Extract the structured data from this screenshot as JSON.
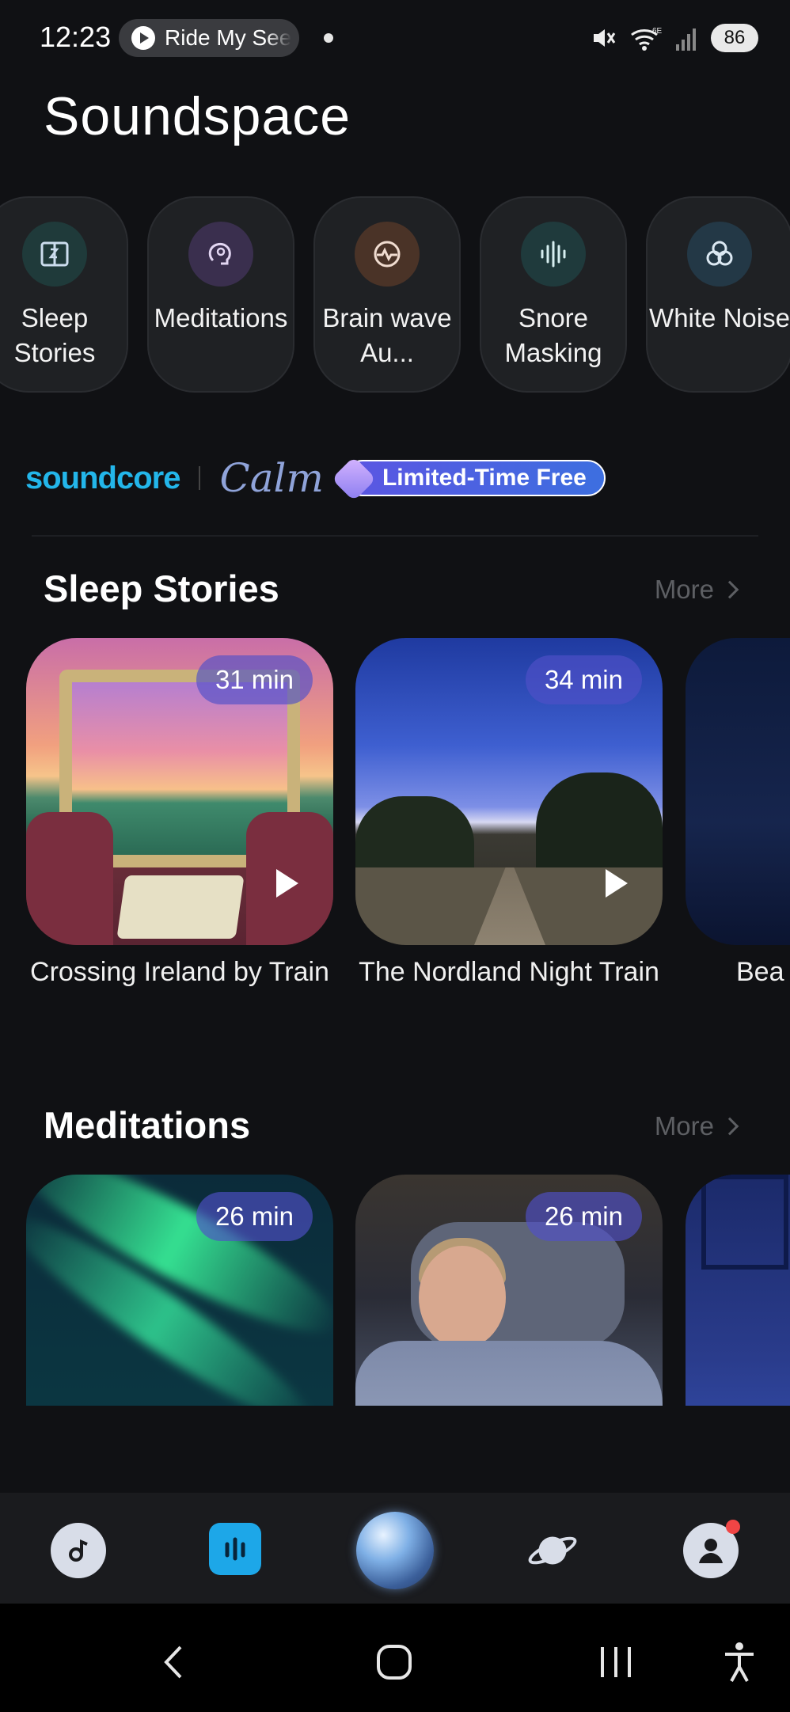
{
  "status_bar": {
    "time": "12:23",
    "media_chip_text": "Ride My See",
    "battery": "86"
  },
  "app": {
    "title": "Soundspace"
  },
  "categories": [
    {
      "label": "Sleep Stories",
      "icon": "book-icon",
      "color": "#1f3a3a"
    },
    {
      "label": "Meditations",
      "icon": "head-icon",
      "color": "#3a2f4e"
    },
    {
      "label": "Brain wave Au...",
      "icon": "brainwave-icon",
      "color": "#4a3327"
    },
    {
      "label": "Snore Masking",
      "icon": "soundwave-icon",
      "color": "#1f3a3c"
    },
    {
      "label": "White Noise",
      "icon": "circles-icon",
      "color": "#233846"
    }
  ],
  "banner": {
    "brand": "soundcore",
    "partner": "Calm",
    "badge": "Limited-Time Free"
  },
  "sleep_stories": {
    "title": "Sleep Stories",
    "more": "More",
    "items": [
      {
        "title": "Crossing Ireland by Train",
        "duration": "31 min"
      },
      {
        "title": "The Nordland Night Train",
        "duration": "34 min"
      },
      {
        "title": "Bea"
      }
    ]
  },
  "meditations": {
    "title": "Meditations",
    "more": "More",
    "items": [
      {
        "duration": "26 min"
      },
      {
        "duration": "26 min"
      }
    ]
  },
  "bottom_nav": [
    {
      "name": "music-icon"
    },
    {
      "name": "soundspace-icon",
      "active": true
    },
    {
      "name": "orb-icon"
    },
    {
      "name": "planet-icon"
    },
    {
      "name": "profile-icon"
    }
  ],
  "colors": {
    "accent": "#23b6ea",
    "background": "#101114"
  }
}
